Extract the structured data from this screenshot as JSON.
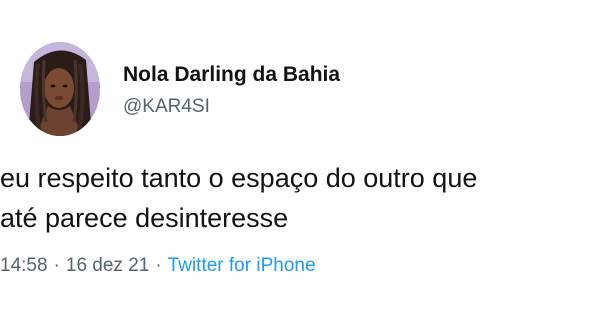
{
  "author": {
    "display_name": "Nola Darling da Bahia",
    "handle": "@KAR4SI"
  },
  "tweet": {
    "lines": [
      "eu respeito tanto o espaço do outro que",
      "até parece desinteresse"
    ]
  },
  "meta": {
    "time": "14:58",
    "date": "16 dez 21",
    "separator": "·",
    "source": "Twitter for iPhone"
  },
  "colors": {
    "text": "#0f1419",
    "secondary": "#536471",
    "link": "#1d9bf0",
    "background": "#ffffff"
  }
}
